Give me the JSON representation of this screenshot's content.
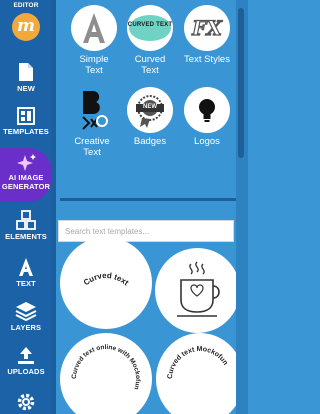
{
  "sidebar": {
    "brand_label": "EDITOR",
    "brand_logo_letter": "M",
    "items": [
      {
        "label": "NEW"
      },
      {
        "label": "TEMPLATES"
      },
      {
        "label": "AI IMAGE",
        "label2": "GENERATOR"
      },
      {
        "label": "ELEMENTS"
      },
      {
        "label": "TEXT"
      },
      {
        "label": "LAYERS"
      },
      {
        "label": "UPLOADS"
      },
      {
        "label": ""
      }
    ]
  },
  "text_tools": [
    {
      "line1": "Simple",
      "line2": "Text"
    },
    {
      "line1": "Curved",
      "line2": "Text"
    },
    {
      "line1": "Text Styles",
      "line2": ""
    },
    {
      "line1": "Creative",
      "line2": "Text"
    },
    {
      "line1": "Badges",
      "line2": ""
    },
    {
      "line1": "Logos",
      "line2": ""
    }
  ],
  "tile_art": {
    "curved_text": "CURVED TEXT",
    "fx": "FX",
    "badge": "NEW"
  },
  "search": {
    "placeholder": "Search text templates..."
  },
  "templates": [
    {
      "text": "Curved text"
    },
    {
      "text": ""
    },
    {
      "text": "Curved text online with Mockofun"
    },
    {
      "text": "Curved text Mockofun"
    }
  ],
  "colors": {
    "sidebar_bg": "#1b63a6",
    "main_bg": "#3a95d5",
    "active_item": "#6b2fc9",
    "brand_logo": "#f2a93b"
  }
}
